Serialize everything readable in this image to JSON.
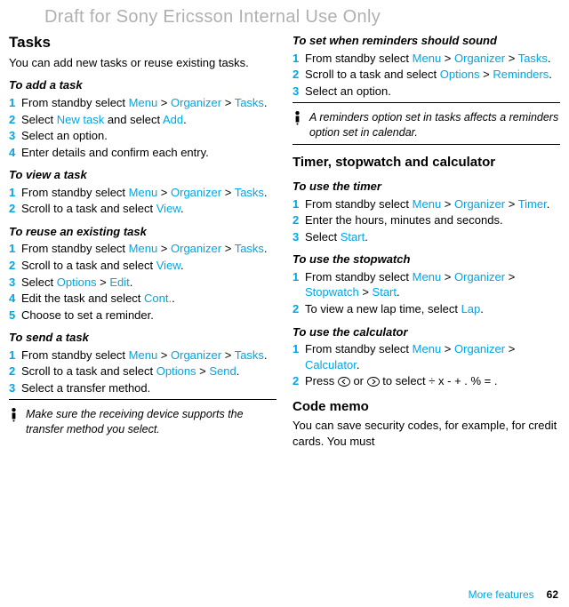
{
  "watermark": "Draft for Sony Ericsson Internal Use Only",
  "left": {
    "tasks_heading": "Tasks",
    "tasks_intro": "You can add new tasks or reuse existing tasks.",
    "add_task": {
      "heading": "To add a task",
      "s1_a": "From standby select ",
      "s1_menu": "Menu",
      "s1_b": " > ",
      "s1_org": "Organizer",
      "s1_c": " > ",
      "s1_tasks": "Tasks",
      "s1_d": ".",
      "s2_a": "Select ",
      "s2_new": "New task",
      "s2_b": " and select ",
      "s2_add": "Add",
      "s2_c": ".",
      "s3": "Select an option.",
      "s4": "Enter details and confirm each entry."
    },
    "view_task": {
      "heading": "To view a task",
      "s1_a": "From standby select ",
      "s1_menu": "Menu",
      "s1_b": " > ",
      "s1_org": "Organizer",
      "s1_c": " > ",
      "s1_tasks": "Tasks",
      "s1_d": ".",
      "s2_a": "Scroll to a task and select ",
      "s2_view": "View",
      "s2_b": "."
    },
    "reuse_task": {
      "heading": "To reuse an existing task",
      "s1_a": "From standby select ",
      "s1_menu": "Menu",
      "s1_b": " > ",
      "s1_org": "Organizer",
      "s1_c": " > ",
      "s1_tasks": "Tasks",
      "s1_d": ".",
      "s2_a": "Scroll to a task and select ",
      "s2_view": "View",
      "s2_b": ".",
      "s3_a": "Select ",
      "s3_opt": "Options",
      "s3_b": " > ",
      "s3_edit": "Edit",
      "s3_c": ".",
      "s4_a": "Edit the task and select ",
      "s4_cont": "Cont.",
      "s4_b": ".",
      "s5": "Choose to set a reminder."
    },
    "send_task": {
      "heading": "To send a task",
      "s1_a": "From standby select ",
      "s1_menu": "Menu",
      "s1_b": " > ",
      "s1_org": "Organizer",
      "s1_c": " > ",
      "s1_tasks": "Tasks",
      "s1_d": ".",
      "s2_a": "Scroll to a task and select ",
      "s2_opt": "Options",
      "s2_b": " > ",
      "s2_send": "Send",
      "s2_c": ".",
      "s3": "Select a transfer method."
    },
    "note1": "Make sure the receiving device supports the transfer method you select."
  },
  "right": {
    "reminders": {
      "heading": "To set when reminders should sound",
      "s1_a": "From standby select ",
      "s1_menu": "Menu",
      "s1_b": " > ",
      "s1_org": "Organizer",
      "s1_c": " > ",
      "s1_tasks": "Tasks",
      "s1_d": ".",
      "s2_a": "Scroll to a task and select ",
      "s2_opt": "Options",
      "s2_b": " > ",
      "s2_rem": "Reminders",
      "s2_c": ".",
      "s3": "Select an option."
    },
    "note2": "A reminders option set in tasks affects a reminders option set in calendar.",
    "tsc_heading": "Timer, stopwatch and calculator",
    "timer": {
      "heading": "To use the timer",
      "s1_a": "From standby select ",
      "s1_menu": "Menu",
      "s1_b": " > ",
      "s1_org": "Organizer",
      "s1_c": " > ",
      "s1_timer": "Timer",
      "s1_d": ".",
      "s2": "Enter the hours, minutes and seconds.",
      "s3_a": "Select ",
      "s3_start": "Start",
      "s3_b": "."
    },
    "stopwatch": {
      "heading": "To use the stopwatch",
      "s1_a": "From standby select ",
      "s1_menu": "Menu",
      "s1_b": " > ",
      "s1_org": "Organizer",
      "s1_c": " > ",
      "s1_sw": "Stopwatch",
      "s1_d": " > ",
      "s1_start": "Start",
      "s1_e": ".",
      "s2_a": "To view a new lap time, select ",
      "s2_lap": "Lap",
      "s2_b": "."
    },
    "calc": {
      "heading": "To use the calculator",
      "s1_a": "From standby select ",
      "s1_menu": "Menu",
      "s1_b": " > ",
      "s1_org": "Organizer",
      "s1_c": " > ",
      "s1_calc": "Calculator",
      "s1_d": ".",
      "s2_a": "Press ",
      "s2_b": " or ",
      "s2_c": " to select ÷ x - + . % = ."
    },
    "code_heading": "Code memo",
    "code_intro": "You can save security codes, for example, for credit cards. You must"
  },
  "footer": {
    "label": "More features",
    "page": "62"
  }
}
